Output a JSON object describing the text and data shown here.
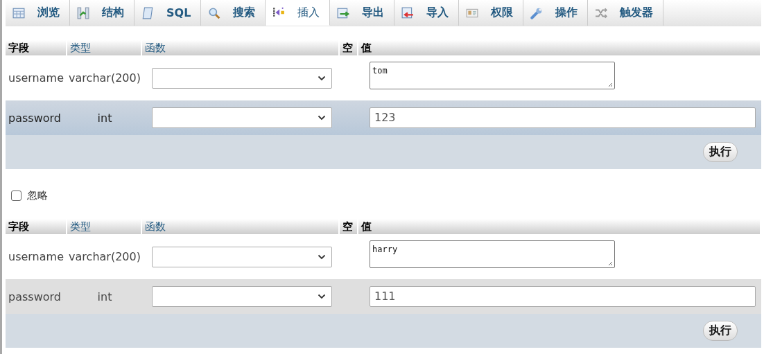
{
  "tabs": [
    {
      "label": "浏览",
      "selected": false
    },
    {
      "label": "结构",
      "selected": false
    },
    {
      "label": "SQL",
      "selected": false
    },
    {
      "label": "搜索",
      "selected": false
    },
    {
      "label": "插入",
      "selected": true
    },
    {
      "label": "导出",
      "selected": false
    },
    {
      "label": "导入",
      "selected": false
    },
    {
      "label": "权限",
      "selected": false
    },
    {
      "label": "操作",
      "selected": false
    },
    {
      "label": "触发器",
      "selected": false
    }
  ],
  "forms": [
    {
      "columns": [
        {
          "label": "字段",
          "link": false
        },
        {
          "label": "类型",
          "link": true
        },
        {
          "label": "函数",
          "link": true
        },
        {
          "label": "空",
          "link": false
        },
        {
          "label": "值",
          "link": false
        }
      ],
      "rows": [
        {
          "field": "username",
          "type": "varchar(200)",
          "kind": "textarea",
          "value": "tom",
          "highlighted": false
        },
        {
          "field": "password",
          "type": "int",
          "kind": "input",
          "value": "123",
          "highlighted": true
        }
      ],
      "button": "执行"
    },
    {
      "ignore": {
        "label": "忽略",
        "checked": false
      },
      "columns": [
        {
          "label": "字段",
          "link": false
        },
        {
          "label": "类型",
          "link": true
        },
        {
          "label": "函数",
          "link": true
        },
        {
          "label": "空",
          "link": false
        },
        {
          "label": "值",
          "link": false
        }
      ],
      "rows": [
        {
          "field": "username",
          "type": "varchar(200)",
          "kind": "textarea",
          "value": "harry",
          "highlighted": false
        },
        {
          "field": "password",
          "type": "int",
          "kind": "input",
          "value": "111",
          "highlighted": false
        }
      ],
      "button": "执行"
    }
  ]
}
